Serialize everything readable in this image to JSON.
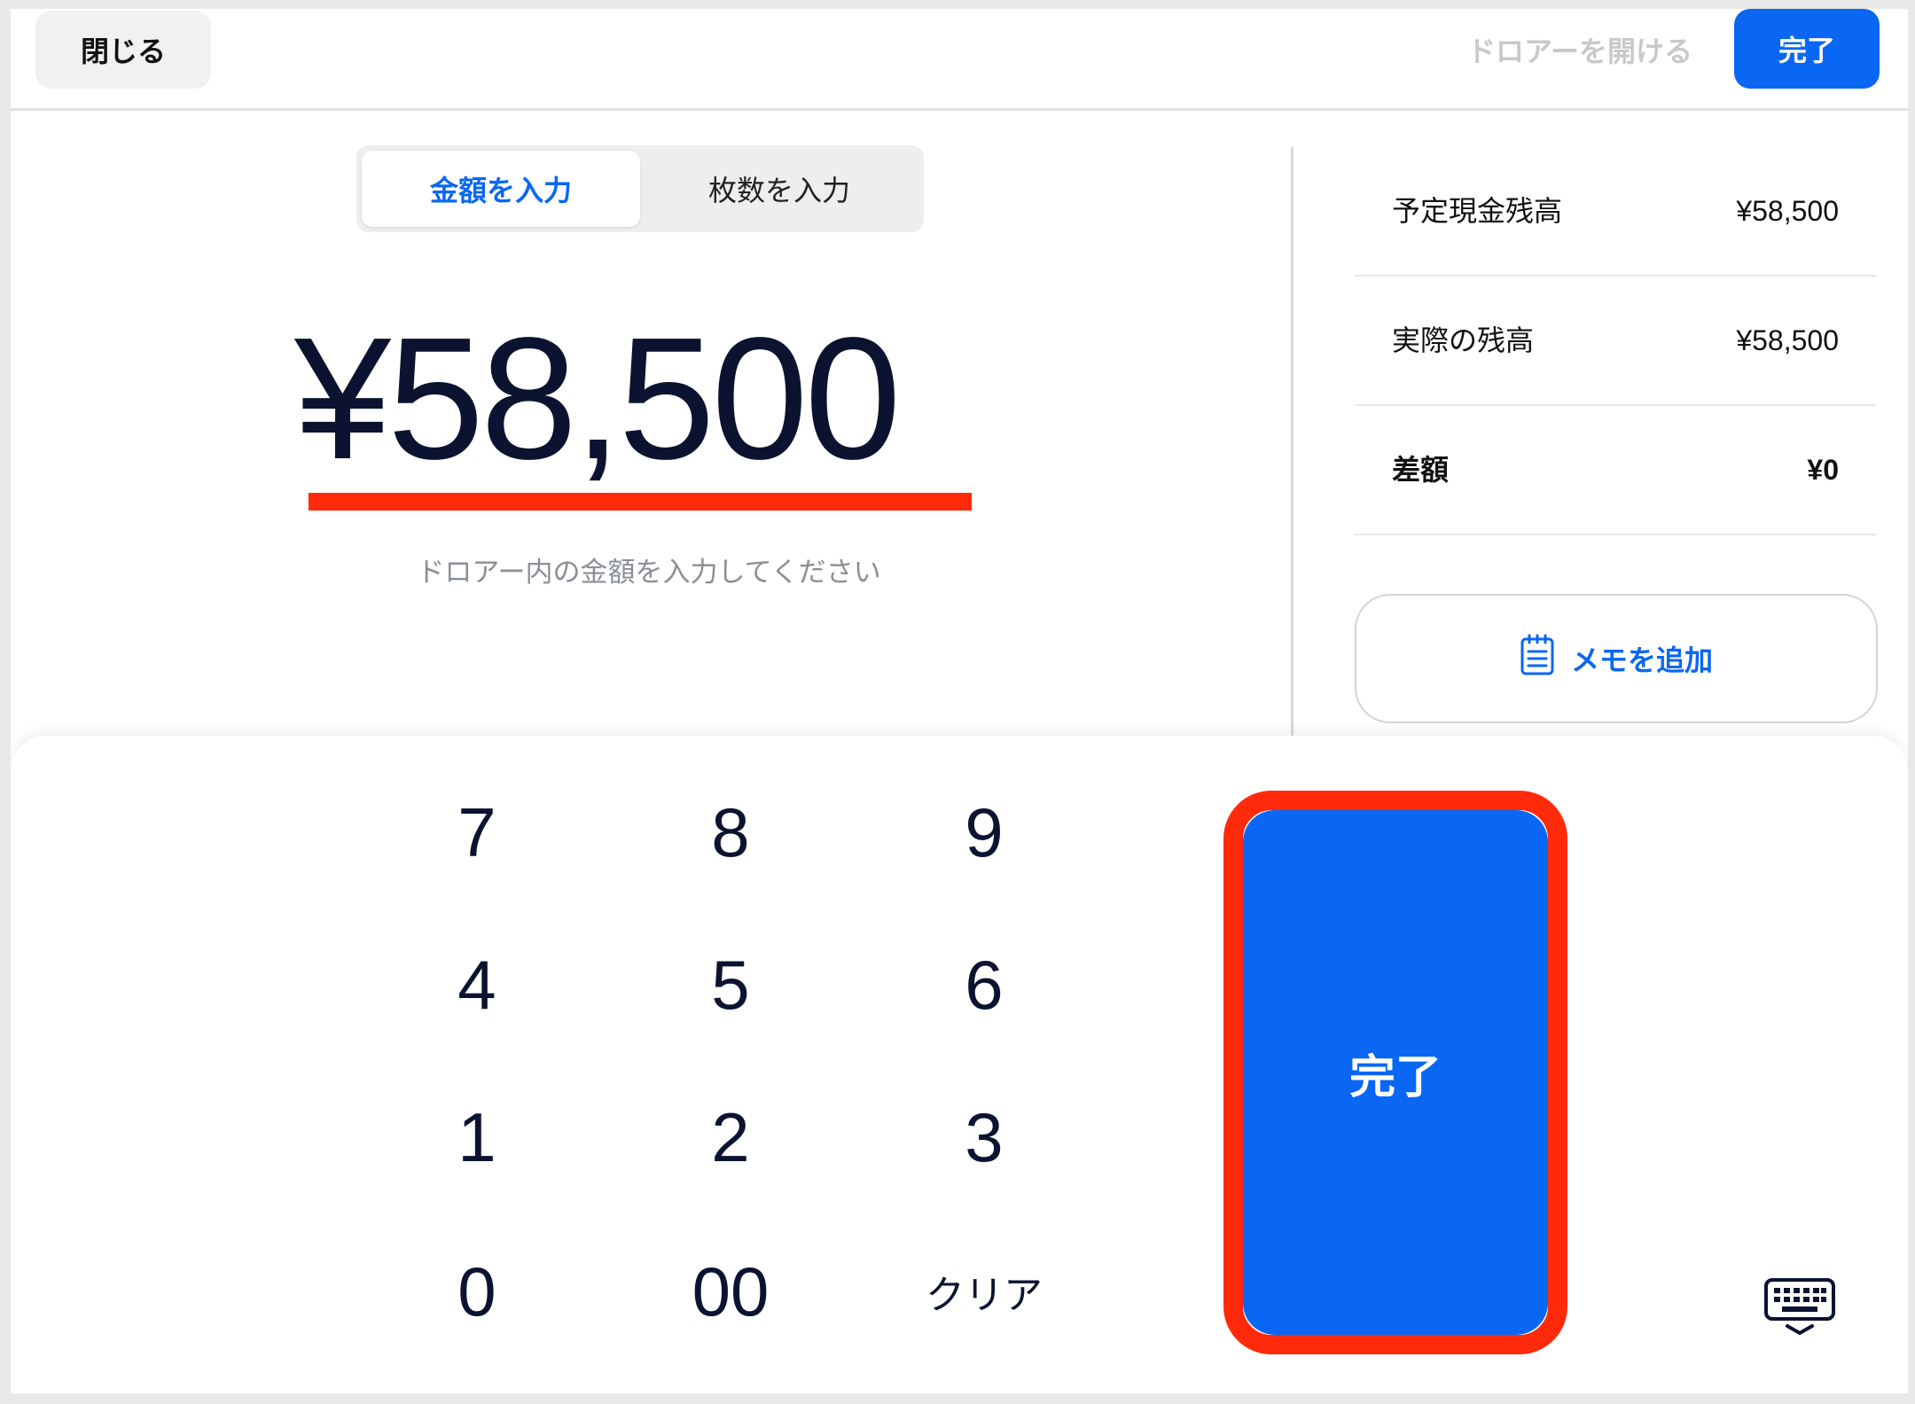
{
  "topbar": {
    "close_label": "閉じる",
    "open_drawer_label": "ドロアーを開ける",
    "done_label": "完了"
  },
  "segmented": {
    "tabs": [
      {
        "label": "金額を入力",
        "active": true
      },
      {
        "label": "枚数を入力",
        "active": false
      }
    ]
  },
  "amount": {
    "value": "¥58,500",
    "hint": "ドロアー内の金額を入力してください"
  },
  "summary": {
    "rows": [
      {
        "label": "予定現金残高",
        "value": "¥58,500"
      },
      {
        "label": "実際の残高",
        "value": "¥58,500"
      },
      {
        "label": "差額",
        "value": "¥0"
      }
    ],
    "memo_label": "メモを追加"
  },
  "keypad": {
    "keys": [
      "7",
      "8",
      "9",
      "4",
      "5",
      "6",
      "1",
      "2",
      "3",
      "0",
      "00",
      "クリア"
    ],
    "done_label": "完了"
  },
  "colors": {
    "accent": "#0a67f4",
    "highlight": "#ff2a0a",
    "muted_text": "#8a8f95",
    "disabled_text": "#c9c9c9"
  },
  "icons": {
    "memo": "notepad-icon",
    "keyboard": "keyboard-hide-icon"
  }
}
